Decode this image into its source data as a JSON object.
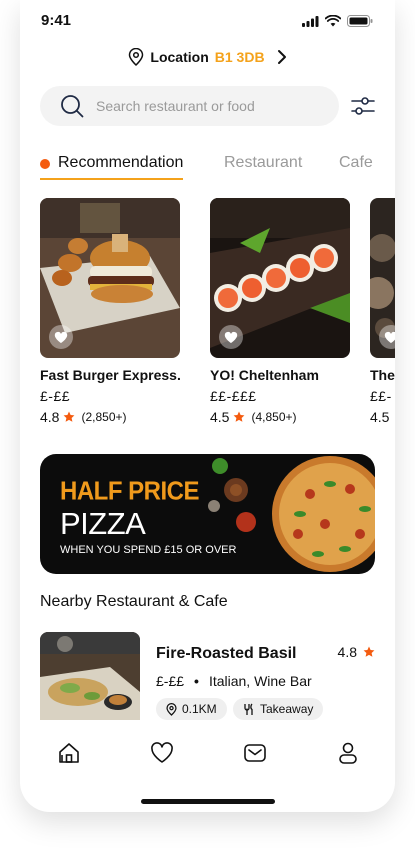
{
  "status_bar": {
    "time": "9:41"
  },
  "location": {
    "label": "Location",
    "code": "B1 3DB"
  },
  "search": {
    "placeholder": "Search restaurant or food"
  },
  "tabs": [
    {
      "label": "Recommendation",
      "active": true
    },
    {
      "label": "Restaurant",
      "active": false
    },
    {
      "label": "Cafe",
      "active": false
    }
  ],
  "cards": [
    {
      "name": "Fast Burger Express...",
      "price": "£-££",
      "rating": "4.8",
      "reviews": "(2,850+)"
    },
    {
      "name": "YO! Cheltenham",
      "price": "££-£££",
      "rating": "4.5",
      "reviews": "(4,850+)"
    },
    {
      "name": "The",
      "price": "££-",
      "rating": "4.5",
      "reviews": ""
    }
  ],
  "promo": {
    "headline": "HALF PRICE",
    "product": "PIZZA",
    "condition": "WHEN YOU SPEND £15 OR OVER"
  },
  "nearby": {
    "section_title": "Nearby Restaurant & Cafe",
    "item": {
      "name": "Fire-Roasted Basil",
      "rating": "4.8",
      "price": "£-££",
      "category": "Italian, Wine Bar",
      "distance": "0.1KM",
      "service": "Takeaway"
    }
  },
  "colors": {
    "accent": "#F4A21B",
    "dot": "#F45B0F",
    "star": "#F45B0F",
    "chip_bg": "#EFEFEF",
    "search_bg": "#F3F3F3"
  },
  "icons": [
    "location-pin-icon",
    "chevron-right-icon",
    "search-icon",
    "filter-icon",
    "heart-icon",
    "star-icon",
    "home-icon",
    "mail-icon",
    "profile-icon",
    "cutlery-icon",
    "signal-icon",
    "wifi-icon",
    "battery-icon"
  ]
}
